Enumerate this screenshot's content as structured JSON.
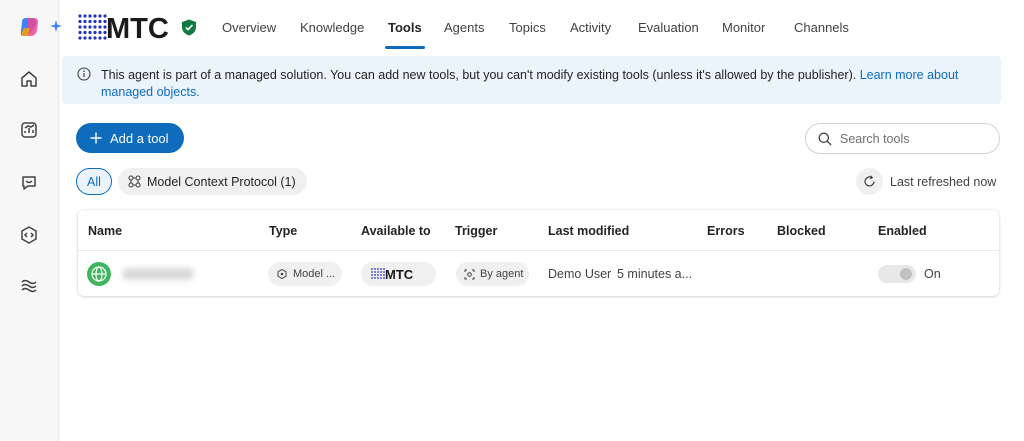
{
  "brand": {
    "logo_text": "MTC",
    "accent": "#0f6cbd",
    "logo_color": "#2433b8",
    "verified_color": "#107c41"
  },
  "rail": {
    "items": [
      {
        "name": "home",
        "icon": "home-icon"
      },
      {
        "name": "analytics",
        "icon": "analytics-icon"
      },
      {
        "name": "conversations",
        "icon": "chat-icon"
      },
      {
        "name": "code",
        "icon": "code-icon"
      },
      {
        "name": "flows",
        "icon": "waves-icon"
      }
    ]
  },
  "tabs": [
    {
      "label": "Overview",
      "active": false
    },
    {
      "label": "Knowledge",
      "active": false
    },
    {
      "label": "Tools",
      "active": true
    },
    {
      "label": "Agents",
      "active": false
    },
    {
      "label": "Topics",
      "active": false
    },
    {
      "label": "Activity",
      "active": false
    },
    {
      "label": "Evaluation",
      "active": false
    },
    {
      "label": "Monitor",
      "active": false
    },
    {
      "label": "Channels",
      "active": false
    }
  ],
  "banner": {
    "text": "This agent is part of a managed solution. You can add new tools, but you can't modify existing tools (unless it's allowed by the publisher).",
    "link": "Learn more about managed objects."
  },
  "actions": {
    "add_tool": "Add a tool"
  },
  "search": {
    "placeholder": "Search tools",
    "value": ""
  },
  "filters": {
    "all": "All",
    "mcp": "Model Context Protocol (1)"
  },
  "refresh": {
    "label": "Last refreshed now"
  },
  "table": {
    "columns": [
      "Name",
      "Type",
      "Available to",
      "Trigger",
      "Last modified",
      "Errors",
      "Blocked",
      "Enabled"
    ],
    "rows": [
      {
        "type": "Model ...",
        "available_to": "MTC",
        "trigger": "By agent",
        "modified_by": "Demo User",
        "modified_when": "5 minutes a...",
        "errors": "",
        "blocked": "",
        "enabled_label": "On"
      }
    ]
  }
}
